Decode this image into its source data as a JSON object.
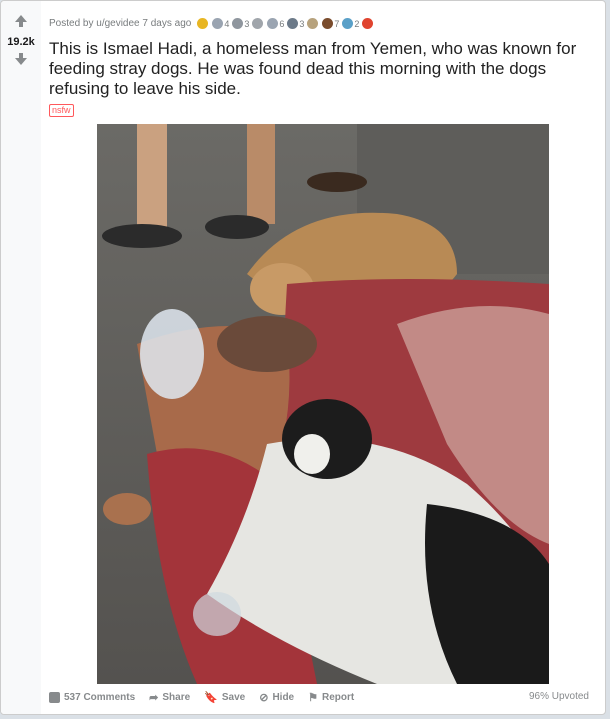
{
  "vote": {
    "score": "19.2k",
    "up_icon": "upvote-arrow-icon",
    "down_icon": "downvote-arrow-icon"
  },
  "post": {
    "meta": "Posted by u/gevidee 7 days ago",
    "title": "This is Ismael Hadi, a homeless man from Yemen, who was known for feeding stray dogs. He was found dead this morning with the dogs refusing to leave his side.",
    "nsfw": "nsfw"
  },
  "awards": [
    {
      "name": "gold-award-icon",
      "count": "",
      "color": "#e8b623"
    },
    {
      "name": "helpful-award-icon",
      "count": "4",
      "color": "#9aa4b1"
    },
    {
      "name": "wholesome-award-icon",
      "count": "3",
      "color": "#8f969e"
    },
    {
      "name": "silver-award-icon",
      "count": "",
      "color": "#a0a5ab"
    },
    {
      "name": "hugz-award-icon",
      "count": "6",
      "color": "#9aa4b1"
    },
    {
      "name": "dollar-award-icon",
      "count": "3",
      "color": "#6c7a89"
    },
    {
      "name": "party-award-icon",
      "count": "",
      "color": "#b7a27d"
    },
    {
      "name": "bear-award-icon",
      "count": "7",
      "color": "#7a4c2d"
    },
    {
      "name": "heartwarming-award-icon",
      "count": "2",
      "color": "#5aa0c8"
    },
    {
      "name": "rocket-award-icon",
      "count": "",
      "color": "#e0442f"
    }
  ],
  "footer": {
    "comments": "537 Comments",
    "share": "Share",
    "save": "Save",
    "hide": "Hide",
    "report": "Report",
    "upvoted": "96% Upvoted"
  }
}
